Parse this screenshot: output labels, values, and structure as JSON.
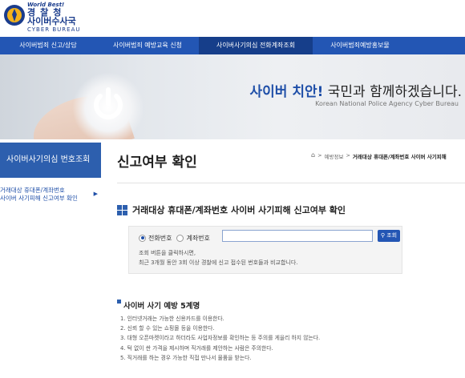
{
  "header": {
    "logo_small": "World Best!",
    "logo_main": "경찰청",
    "logo_sub": "사이버수사국",
    "logo_en": "CYBER BUREAU"
  },
  "nav": {
    "items": [
      {
        "label": "사이버범죄 신고/상담",
        "active": false
      },
      {
        "label": "사이버범죄 예방교육 신청",
        "active": false
      },
      {
        "label": "사이버사기의심 전화계좌조회",
        "active": true
      },
      {
        "label": "사이버범죄예방홍보물",
        "active": false
      }
    ]
  },
  "banner": {
    "title_highlight": "사이버 치안!",
    "title_rest": " 국민과 함께하겠습니다.",
    "subtitle": "Korean National Police Agency Cyber Bureau"
  },
  "sidebar": {
    "heading": "사이버사기의심 번호조회",
    "item_line1": "거래대상 휴대폰/계좌번호",
    "item_line2": "사이버 사기피해 신고여부 확인",
    "item_arrow": "▶"
  },
  "main": {
    "page_title": "신고여부 확인",
    "breadcrumb": {
      "home": "⌂",
      "sep": ">",
      "parent": "예방정보",
      "current": "거래대상 휴대폰/계좌번호 사이버 사기피해"
    },
    "section_title": "거래대상 휴대폰/계좌번호 사이버 사기피해 신고여부 확인",
    "search": {
      "radio_phone": "전화번호",
      "radio_account": "계좌번호",
      "selected": "phone",
      "input_value": "",
      "button_label": "조회",
      "note_line1": "조회 버튼을 클릭하시면,",
      "note_line2": "최근 3개월 동안 3회 이상 경찰에 신고 접수된 번호들과 비교합니다."
    },
    "tips": {
      "title": "사이버 사기 예방 5계명",
      "items": [
        "1. 인터넷거래는 가능한 신용카드를 이용한다.",
        "2. 신뢰 할 수 있는 쇼핑몰 등을 이용한다.",
        "3. 대형 오픈마켓이라고 하더라도 사업자정보를 확인하는 등 주의를 게을리 하지 않는다.",
        "4. 턱 없이 싼 가격을 제시하며 직거래를 제안하는 사람은 주의한다.",
        "5. 직거래를 하는 경우 가능한 직접 만나서 물품을 받는다."
      ]
    }
  },
  "colors": {
    "nav_bg": "#2356b4",
    "nav_active": "#163e8a",
    "accent": "#2d5fae",
    "brand_text": "#1a3c8c"
  }
}
